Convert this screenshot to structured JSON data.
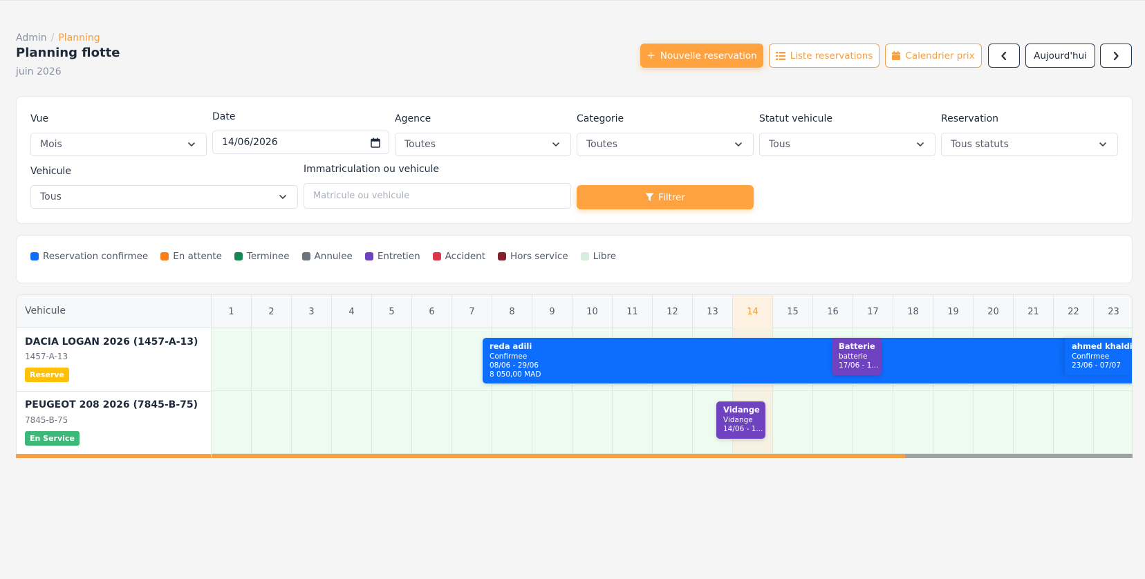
{
  "breadcrumb": {
    "parent": "Admin",
    "current": "Planning"
  },
  "page": {
    "title": "Planning flotte",
    "period": "juin 2026"
  },
  "toolbar": {
    "new_reservation": "Nouvelle reservation",
    "list_reservations": "Liste reservations",
    "price_calendar": "Calendrier prix",
    "today": "Aujourd'hui"
  },
  "filters": {
    "view": {
      "label": "Vue",
      "value": "Mois"
    },
    "date": {
      "label": "Date",
      "value": "14/06/2026"
    },
    "agency": {
      "label": "Agence",
      "value": "Toutes"
    },
    "category": {
      "label": "Categorie",
      "value": "Toutes"
    },
    "vehicle_status": {
      "label": "Statut vehicule",
      "value": "Tous"
    },
    "reservation": {
      "label": "Reservation",
      "value": "Tous statuts"
    },
    "vehicle": {
      "label": "Vehicule",
      "value": "Tous"
    },
    "search": {
      "label": "Immatriculation ou vehicule",
      "placeholder": "Matricule ou vehicule"
    },
    "submit": "Filtrer"
  },
  "legend": [
    {
      "label": "Reservation confirmee",
      "color": "#0d6efd"
    },
    {
      "label": "En attente",
      "color": "#fd7e14"
    },
    {
      "label": "Terminee",
      "color": "#198754"
    },
    {
      "label": "Annulee",
      "color": "#6c757d"
    },
    {
      "label": "Entretien",
      "color": "#6f42c1"
    },
    {
      "label": "Accident",
      "color": "#dc3545"
    },
    {
      "label": "Hors service",
      "color": "#842029"
    },
    {
      "label": "Libre",
      "color": "#d7ecdf"
    }
  ],
  "planning": {
    "vehicle_header": "Vehicule",
    "days": [
      "1",
      "2",
      "3",
      "4",
      "5",
      "6",
      "7",
      "8",
      "9",
      "10",
      "11",
      "12",
      "13",
      "14",
      "15",
      "16",
      "17",
      "18",
      "19",
      "20",
      "21",
      "22",
      "23"
    ],
    "today_day": "14",
    "vehicles": [
      {
        "name": "DACIA LOGAN 2026 (1457-A-13)",
        "plate": "1457-A-13",
        "status": "Reserve",
        "status_color": "#ffc107"
      },
      {
        "name": "PEUGEOT 208 2026 (7845-B-75)",
        "plate": "7845-B-75",
        "status": "En Service",
        "status_color": "#3cb878"
      }
    ],
    "events": [
      {
        "name": "reda adili",
        "status": "Confirmee",
        "dates": "08/06 - 29/06",
        "amount": "8 050,00 MAD",
        "color": "#0d6efd"
      },
      {
        "name": "Batterie",
        "status": "batterie",
        "dates": "17/06 - 1...",
        "color": "#6f42c1"
      },
      {
        "name": "ahmed khaldi",
        "status": "Confirmee",
        "dates": "23/06 - 07/07",
        "color": "#0d6efd"
      },
      {
        "name": "Vidange",
        "status": "Vidange",
        "dates": "14/06 - 1...",
        "color": "#6f42c1"
      }
    ]
  },
  "icons": [
    "plus-icon",
    "list-icon",
    "calendar-icon",
    "chevron-left-icon",
    "chevron-right-icon",
    "chevron-down-icon",
    "filter-icon"
  ]
}
